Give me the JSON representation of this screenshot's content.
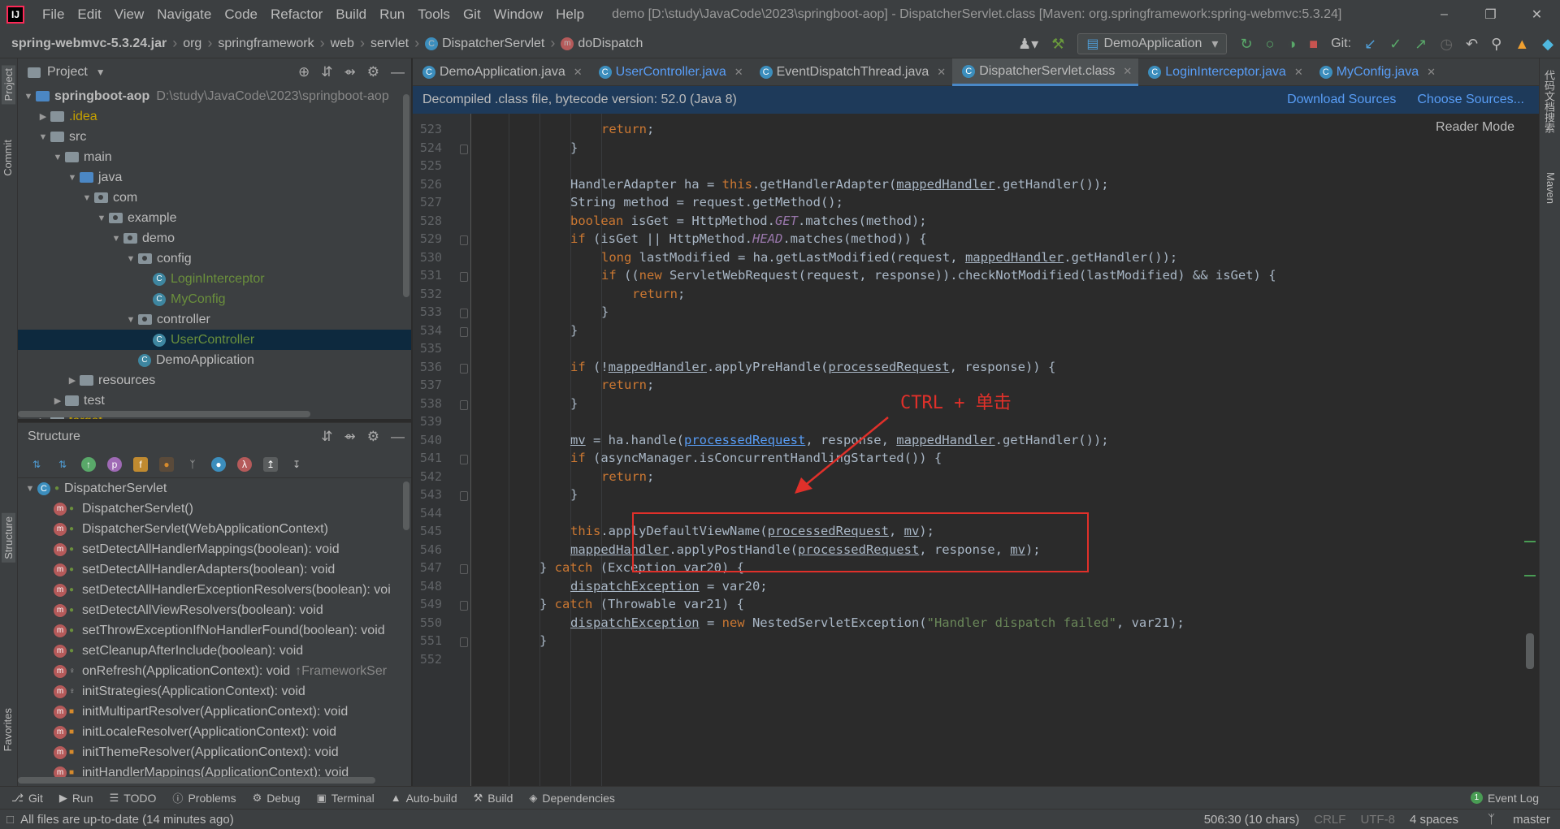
{
  "app": {
    "logo": "IJ",
    "menu": [
      "File",
      "Edit",
      "View",
      "Navigate",
      "Code",
      "Refactor",
      "Build",
      "Run",
      "Tools",
      "Git",
      "Window",
      "Help"
    ],
    "window_title": "demo [D:\\study\\JavaCode\\2023\\springboot-aop] - DispatcherServlet.class [Maven: org.springframework:spring-webmvc:5.3.24]",
    "window_controls": [
      "–",
      "❐",
      "✕"
    ]
  },
  "breadcrumb": [
    "spring-webmvc-5.3.24.jar",
    "org",
    "springframework",
    "web",
    "servlet",
    "DispatcherServlet",
    "doDispatch"
  ],
  "toolbar": {
    "run_config": "DemoApplication",
    "git_label": "Git:"
  },
  "left_strip": [
    "Project",
    "Commit",
    "Structure",
    "Favorites"
  ],
  "right_strip": [
    "代码文档搜索",
    "Maven"
  ],
  "project": {
    "title": "Project",
    "root_name": "springboot-aop",
    "root_path": "D:\\study\\JavaCode\\2023\\springboot-aop",
    "items": [
      {
        "label": ".idea",
        "depth": 1,
        "type": "folder",
        "arrow": "▶",
        "color": "yellow"
      },
      {
        "label": "src",
        "depth": 1,
        "type": "folder",
        "arrow": "▼"
      },
      {
        "label": "main",
        "depth": 2,
        "type": "folder",
        "arrow": "▼"
      },
      {
        "label": "java",
        "depth": 3,
        "type": "folder-blue",
        "arrow": "▼"
      },
      {
        "label": "com",
        "depth": 4,
        "type": "package",
        "arrow": "▼"
      },
      {
        "label": "example",
        "depth": 5,
        "type": "package",
        "arrow": "▼"
      },
      {
        "label": "demo",
        "depth": 6,
        "type": "package",
        "arrow": "▼"
      },
      {
        "label": "config",
        "depth": 7,
        "type": "package",
        "arrow": "▼"
      },
      {
        "label": "LoginInterceptor",
        "depth": 8,
        "type": "class",
        "color": "green"
      },
      {
        "label": "MyConfig",
        "depth": 8,
        "type": "class",
        "color": "green"
      },
      {
        "label": "controller",
        "depth": 7,
        "type": "package",
        "arrow": "▼"
      },
      {
        "label": "UserController",
        "depth": 8,
        "type": "class",
        "color": "green",
        "selected": true
      },
      {
        "label": "DemoApplication",
        "depth": 7,
        "type": "class"
      },
      {
        "label": "resources",
        "depth": 3,
        "type": "folder",
        "arrow": "▶"
      },
      {
        "label": "test",
        "depth": 2,
        "type": "folder",
        "arrow": "▶"
      },
      {
        "label": "target",
        "depth": 1,
        "type": "folder",
        "arrow": "▶",
        "color": "yellow"
      }
    ]
  },
  "structure": {
    "title": "Structure",
    "root": "DispatcherServlet",
    "members": [
      {
        "label": "DispatcherServlet()",
        "vis": "public"
      },
      {
        "label": "DispatcherServlet(WebApplicationContext)",
        "vis": "public"
      },
      {
        "label": "setDetectAllHandlerMappings(boolean): void",
        "vis": "public"
      },
      {
        "label": "setDetectAllHandlerAdapters(boolean): void",
        "vis": "public"
      },
      {
        "label": "setDetectAllHandlerExceptionResolvers(boolean): voi",
        "vis": "public"
      },
      {
        "label": "setDetectAllViewResolvers(boolean): void",
        "vis": "public"
      },
      {
        "label": "setThrowExceptionIfNoHandlerFound(boolean): void",
        "vis": "public"
      },
      {
        "label": "setCleanupAfterInclude(boolean): void",
        "vis": "public"
      },
      {
        "label": "onRefresh(ApplicationContext): void",
        "vis": "protected",
        "suffix": "↑FrameworkSer"
      },
      {
        "label": "initStrategies(ApplicationContext): void",
        "vis": "protected"
      },
      {
        "label": "initMultipartResolver(ApplicationContext): void",
        "vis": "private"
      },
      {
        "label": "initLocaleResolver(ApplicationContext): void",
        "vis": "private"
      },
      {
        "label": "initThemeResolver(ApplicationContext): void",
        "vis": "private"
      },
      {
        "label": "initHandlerMappings(ApplicationContext): void",
        "vis": "private"
      }
    ]
  },
  "tabs": [
    {
      "label": "DemoApplication.java",
      "color": "default"
    },
    {
      "label": "UserController.java",
      "color": "blue"
    },
    {
      "label": "EventDispatchThread.java",
      "color": "default"
    },
    {
      "label": "DispatcherServlet.class",
      "color": "default",
      "active": true
    },
    {
      "label": "LoginInterceptor.java",
      "color": "blue"
    },
    {
      "label": "MyConfig.java",
      "color": "blue"
    }
  ],
  "banner": {
    "text": "Decompiled .class file, bytecode version: 52.0 (Java 8)",
    "download": "Download Sources",
    "choose": "Choose Sources..."
  },
  "reader_mode": "Reader Mode",
  "annotation": "CTRL + 单击",
  "code": {
    "line_numbers": [
      "523",
      "524",
      "525",
      "526",
      "527",
      "528",
      "529",
      "530",
      "531",
      "532",
      "533",
      "534",
      "535",
      "536",
      "537",
      "538",
      "539",
      "540",
      "541",
      "542",
      "543",
      "544",
      "545",
      "546",
      "547",
      "548",
      "549",
      "550",
      "551",
      "552"
    ],
    "lines": [
      {
        "i": 4,
        "html": "<span class='kw'>return</span>;"
      },
      {
        "i": 3,
        "html": "}"
      },
      {
        "i": 3,
        "html": ""
      },
      {
        "i": 3,
        "html": "HandlerAdapter ha = <span class='kw'>this</span>.getHandlerAdapter(<span class='ul'>mappedHandler</span>.getHandler());"
      },
      {
        "i": 3,
        "html": "String method = request.getMethod();"
      },
      {
        "i": 3,
        "html": "<span class='kw'>boolean</span> isGet = HttpMethod.<span class='fi'>GET</span>.matches(method);"
      },
      {
        "i": 3,
        "html": "<span class='kw'>if</span> (isGet || HttpMethod.<span class='fi'>HEAD</span>.matches(method)) {"
      },
      {
        "i": 4,
        "html": "<span class='kw'>long</span> lastModified = ha.getLastModified(request, <span class='ul'>mappedHandler</span>.getHandler());"
      },
      {
        "i": 4,
        "html": "<span class='kw'>if</span> ((<span class='kw'>new</span> ServletWebRequest(request, response)).checkNotModified(lastModified) &amp;&amp; isGet) {"
      },
      {
        "i": 5,
        "html": "<span class='kw'>return</span>;"
      },
      {
        "i": 4,
        "html": "}"
      },
      {
        "i": 3,
        "html": "}"
      },
      {
        "i": 3,
        "html": ""
      },
      {
        "i": 3,
        "html": "<span class='kw'>if</span> (!<span class='ul'>mappedHandler</span>.applyPreHandle(<span class='ul'>processedRequest</span>, response)) {"
      },
      {
        "i": 4,
        "html": "<span class='kw'>return</span>;"
      },
      {
        "i": 3,
        "html": "}"
      },
      {
        "i": 3,
        "html": ""
      },
      {
        "i": 3,
        "html": "<span class='ul'>mv</span> = ha.handle(<span class='ul' style='color:#589df6'>processedRequest</span>, response, <span class='ul'>mappedHandler</span>.getHandler());"
      },
      {
        "i": 3,
        "html": "<span class='kw'>if</span> (asyncManager.isConcurrentHandlingStarted()) {"
      },
      {
        "i": 4,
        "html": "<span class='kw'>return</span>;"
      },
      {
        "i": 3,
        "html": "}"
      },
      {
        "i": 3,
        "html": ""
      },
      {
        "i": 3,
        "html": "<span class='kw'>this</span>.applyDefaultViewName(<span class='ul'>processedRequest</span>, <span class='ul'>mv</span>);"
      },
      {
        "i": 3,
        "html": "<span class='ul'>mappedHandler</span>.applyPostHandle(<span class='ul'>processedRequest</span>, response, <span class='ul'>mv</span>);"
      },
      {
        "i": 2,
        "html": "} <span class='kw'>catch</span> (Exception var20) {"
      },
      {
        "i": 3,
        "html": "<span class='ul'>dispatchException</span> = var20;"
      },
      {
        "i": 2,
        "html": "} <span class='kw'>catch</span> (Throwable var21) {"
      },
      {
        "i": 3,
        "html": "<span class='ul'>dispatchException</span> = <span class='kw'>new</span> NestedServletException(<span class='str'>\"Handler dispatch failed\"</span>, var21);"
      },
      {
        "i": 2,
        "html": "}"
      },
      {
        "i": 2,
        "html": ""
      }
    ],
    "fold_lines": [
      1,
      6,
      8,
      10,
      11,
      13,
      15,
      18,
      20,
      24,
      26,
      28
    ]
  },
  "bottom_tools": [
    {
      "icon": "⎇",
      "label": "Git"
    },
    {
      "icon": "▶",
      "label": "Run"
    },
    {
      "icon": "☰",
      "label": "TODO"
    },
    {
      "icon": "ⓘ",
      "label": "Problems"
    },
    {
      "icon": "⚙",
      "label": "Debug"
    },
    {
      "icon": "▣",
      "label": "Terminal"
    },
    {
      "icon": "▲",
      "label": "Auto-build"
    },
    {
      "icon": "⚒",
      "label": "Build"
    },
    {
      "icon": "◈",
      "label": "Dependencies"
    }
  ],
  "event_log": "Event Log",
  "event_count": "1",
  "status": {
    "message": "All files are up-to-date (14 minutes ago)",
    "position": "506:30 (10 chars)",
    "line_sep": "CRLF",
    "encoding": "UTF-8",
    "indent": "4 spaces",
    "branch": "master"
  }
}
